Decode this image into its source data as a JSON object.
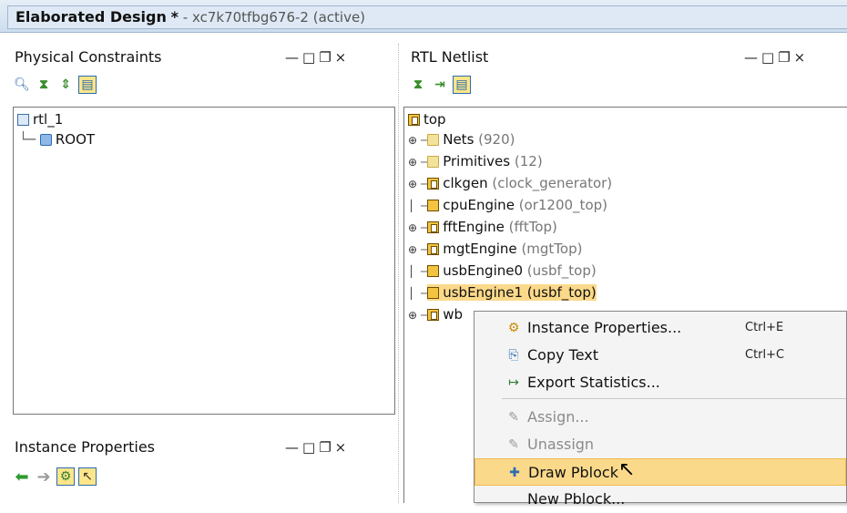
{
  "window": {
    "title": "Elaborated Design",
    "modified": "*",
    "subtitle": "- xc7k70tfbg676-2",
    "state": "(active)"
  },
  "window_controls": [
    "—",
    "□",
    "❐",
    "×"
  ],
  "physical_constraints": {
    "title": "Physical Constraints",
    "toolbar_icons": [
      "search-icon",
      "collapse-all-icon",
      "expand-all-icon",
      "auto-select-icon"
    ],
    "tree": [
      {
        "label": "rtl_1",
        "icon": "constraint-set-icon"
      },
      {
        "label": "ROOT",
        "icon": "pblock-icon"
      }
    ]
  },
  "rtl_netlist": {
    "title": "RTL Netlist",
    "toolbar_icons": [
      "collapse-all-icon",
      "expand-icon",
      "auto-select-icon"
    ],
    "root": "top",
    "items": [
      {
        "name": "Nets",
        "detail": "(920)",
        "icon": "folder",
        "expandable": true
      },
      {
        "name": "Primitives",
        "detail": "(12)",
        "icon": "folder",
        "expandable": true
      },
      {
        "name": "clkgen",
        "detail": "(clock_generator)",
        "icon": "hier",
        "expandable": true
      },
      {
        "name": "cpuEngine",
        "detail": "(or1200_top)",
        "icon": "chip",
        "expandable": false
      },
      {
        "name": "fftEngine",
        "detail": "(fftTop)",
        "icon": "hier",
        "expandable": true
      },
      {
        "name": "mgtEngine",
        "detail": "(mgtTop)",
        "icon": "hier",
        "expandable": true
      },
      {
        "name": "usbEngine0",
        "detail": "(usbf_top)",
        "icon": "chip",
        "expandable": false
      },
      {
        "name": "usbEngine1 (usbf_top)",
        "detail": "",
        "icon": "chip",
        "expandable": false,
        "selected": true
      },
      {
        "name": "wb",
        "detail": "",
        "icon": "hier",
        "expandable": true
      }
    ]
  },
  "instance_properties": {
    "title": "Instance Properties",
    "toolbar_icons": [
      "back-arrow-icon",
      "forward-arrow-icon",
      "settings-icon",
      "select-icon"
    ]
  },
  "context_menu": {
    "items": [
      {
        "label": "Instance Properties...",
        "shortcut": "Ctrl+E",
        "icon": "properties-icon",
        "enabled": true
      },
      {
        "label": "Copy Text",
        "shortcut": "Ctrl+C",
        "icon": "copy-icon",
        "enabled": true
      },
      {
        "label": "Export Statistics...",
        "shortcut": "",
        "icon": "export-icon",
        "enabled": true
      },
      {
        "label": "Assign...",
        "shortcut": "",
        "icon": "assign-icon",
        "enabled": false
      },
      {
        "label": "Unassign",
        "shortcut": "",
        "icon": "unassign-icon",
        "enabled": false
      },
      {
        "label": "Draw Pblock",
        "shortcut": "",
        "icon": "draw-pblock-icon",
        "enabled": true,
        "highlighted": true
      },
      {
        "label": "New Pblock...",
        "shortcut": "",
        "icon": "",
        "enabled": true
      }
    ]
  }
}
